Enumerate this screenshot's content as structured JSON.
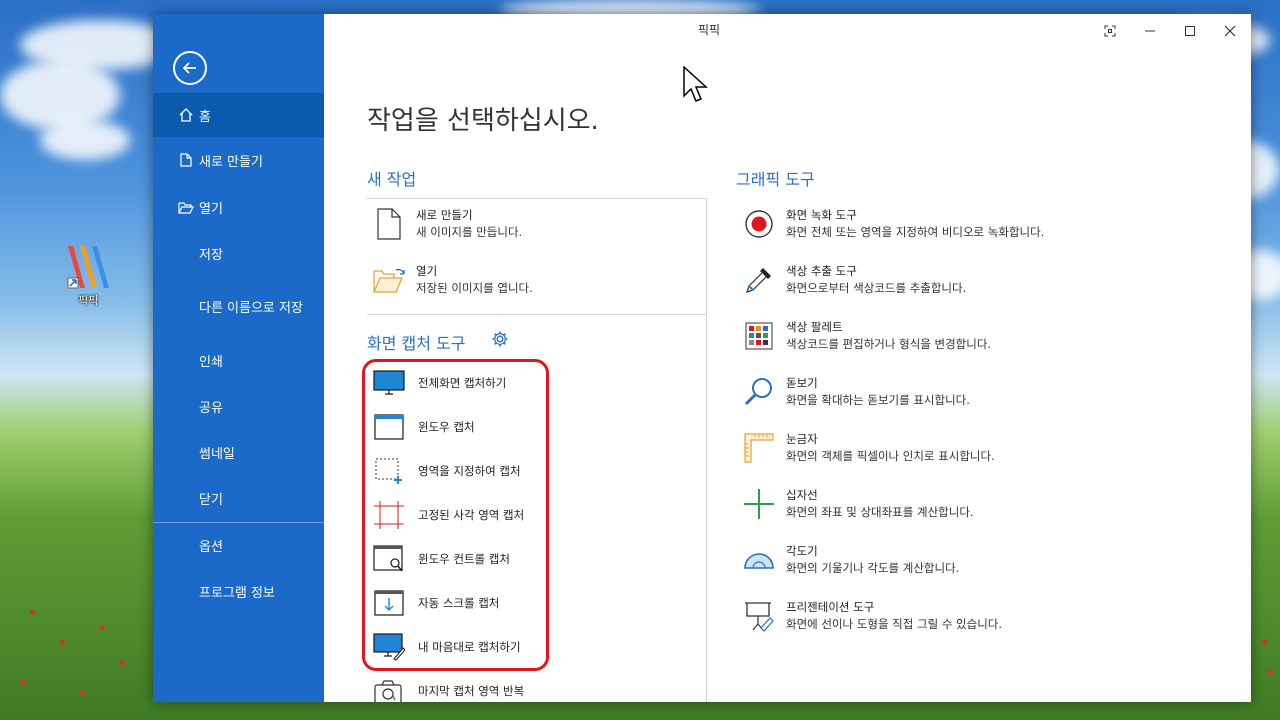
{
  "desktop": {
    "icon_label": "픽픽"
  },
  "window": {
    "title": "픽픽",
    "heading": "작업을 선택하십시오."
  },
  "sidebar": {
    "items": [
      {
        "label": "홈",
        "icon": "home-icon"
      },
      {
        "label": "새로 만들기",
        "icon": "new-file-icon"
      },
      {
        "label": "열기",
        "icon": "folder-open-icon"
      },
      {
        "label": "저장"
      },
      {
        "label": "다른 이름으로 저장"
      },
      {
        "label": "인쇄"
      },
      {
        "label": "공유"
      },
      {
        "label": "썸네일"
      },
      {
        "label": "닫기"
      },
      {
        "label": "옵션"
      },
      {
        "label": "프로그램 정보"
      }
    ]
  },
  "new_task": {
    "header": "새 작업",
    "items": [
      {
        "name": "새로 만들기",
        "desc": "새 이미지를 만듭니다."
      },
      {
        "name": "열기",
        "desc": "저장된 이미지를 엽니다."
      }
    ]
  },
  "capture": {
    "header": "화면 캡처 도구",
    "items": [
      "전체화면 캡처하기",
      "윈도우 캡처",
      "영역을 지정하여 캡처",
      "고정된 사각 영역 캡처",
      "윈도우 컨트롤 캡처",
      "자동 스크롤 캡처",
      "내 마음대로 캡처하기",
      "마지막 캡처 영역 반복"
    ]
  },
  "graphic": {
    "header": "그래픽 도구",
    "items": [
      {
        "name": "화면 녹화 도구",
        "desc": "화면 전체 또는 영역을 지정하여 비디오로 녹화합니다."
      },
      {
        "name": "색상 추출 도구",
        "desc": "화면으로부터 색상코드를 추출합니다."
      },
      {
        "name": "색상 팔레트",
        "desc": "색상코드를 편집하거나 형식을 변경합니다."
      },
      {
        "name": "돋보기",
        "desc": "화면을 확대하는 돋보기를 표시합니다."
      },
      {
        "name": "눈금자",
        "desc": "화면의 객체를 픽셀이나 인치로 표시합니다."
      },
      {
        "name": "십자선",
        "desc": "화면의 좌표 및 상대좌표를 계산합니다."
      },
      {
        "name": "각도기",
        "desc": "화면의 기울기나 각도를 계산합니다."
      },
      {
        "name": "프리젠테이션 도구",
        "desc": "화면에 선이나 도형을 직접 그릴 수 있습니다."
      }
    ]
  },
  "colors": {
    "sidebar": "#1b6ac9",
    "accent": "#2a6fc4",
    "highlight": "#e0161e"
  }
}
